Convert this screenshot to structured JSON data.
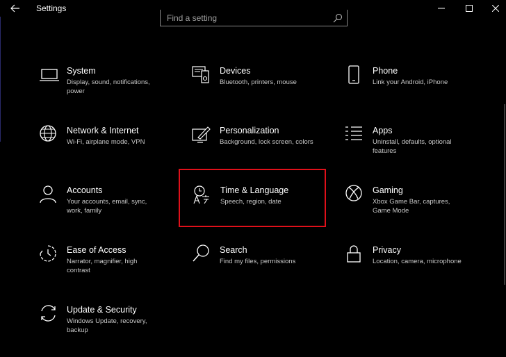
{
  "window": {
    "title": "Settings"
  },
  "search": {
    "placeholder": "Find a setting"
  },
  "colors": {
    "background": "#000000",
    "highlight": "#e0101a",
    "description_text": "#c8c8c8"
  },
  "tiles": [
    {
      "label": "System",
      "desc": "Display, sound, notifications, power",
      "icon": "laptop-icon"
    },
    {
      "label": "Devices",
      "desc": "Bluetooth, printers, mouse",
      "icon": "keyboard-speaker-icon"
    },
    {
      "label": "Phone",
      "desc": "Link your Android, iPhone",
      "icon": "phone-icon"
    },
    {
      "label": "Network & Internet",
      "desc": "Wi-Fi, airplane mode, VPN",
      "icon": "globe-icon"
    },
    {
      "label": "Personalization",
      "desc": "Background, lock screen, colors",
      "icon": "paint-pen-icon"
    },
    {
      "label": "Apps",
      "desc": "Uninstall, defaults, optional features",
      "icon": "apps-list-icon"
    },
    {
      "label": "Accounts",
      "desc": "Your accounts, email, sync, work, family",
      "icon": "person-icon"
    },
    {
      "label": "Time & Language",
      "desc": "Speech, region, date",
      "icon": "time-language-icon",
      "highlighted": true
    },
    {
      "label": "Gaming",
      "desc": "Xbox Game Bar, captures, Game Mode",
      "icon": "xbox-icon"
    },
    {
      "label": "Ease of Access",
      "desc": "Narrator, magnifier, high contrast",
      "icon": "ease-of-access-icon"
    },
    {
      "label": "Search",
      "desc": "Find my files, permissions",
      "icon": "search-icon"
    },
    {
      "label": "Privacy",
      "desc": "Location, camera, microphone",
      "icon": "lock-icon"
    },
    {
      "label": "Update & Security",
      "desc": "Windows Update, recovery, backup",
      "icon": "sync-arrows-icon"
    }
  ]
}
